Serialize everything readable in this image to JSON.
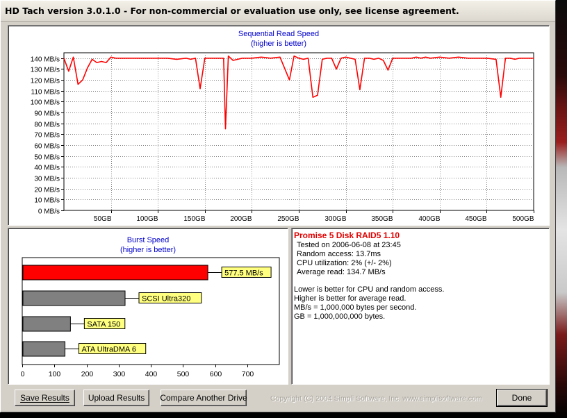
{
  "window": {
    "title": "HD Tach version 3.0.1.0  - For non-commercial or evaluation use only, see license agreement."
  },
  "sequential": {
    "title": "Sequential Read Speed",
    "subtitle": "(higher is better)"
  },
  "burst": {
    "title": "Burst Speed",
    "subtitle": "(higher is better)"
  },
  "info": {
    "title": "Promise 5 Disk RAID5 1.10",
    "tested_on": "Tested on 2006-06-08 at 23:45",
    "random_access": "Random access: 13.7ms",
    "cpu": "CPU utilization: 2% (+/- 2%)",
    "avg_read": "Average read: 134.7 MB/s",
    "notes": [
      "Lower is better for CPU and random access.",
      "Higher is better for average read.",
      "MB/s = 1,000,000 bytes per second.",
      "GB = 1,000,000,000 bytes."
    ]
  },
  "buttons": {
    "save": "Save Results",
    "upload": "Upload Results",
    "compare": "Compare Another Drive",
    "done": "Done"
  },
  "copyright": "Copyright (C) 2004 Simpli Software, Inc. www.simplisoftware.com",
  "chart_data": [
    {
      "type": "line",
      "title": "Sequential Read Speed",
      "subtitle": "(higher is better)",
      "x_unit": "GB",
      "y_unit": "MB/s",
      "xlim": [
        0,
        500
      ],
      "ylim": [
        0,
        145
      ],
      "x_ticks": [
        50,
        100,
        150,
        200,
        250,
        300,
        350,
        400,
        450,
        500
      ],
      "x_tick_labels": [
        "50GB",
        "100GB",
        "150GB",
        "200GB",
        "250GB",
        "300GB",
        "350GB",
        "400GB",
        "450GB",
        "500GB"
      ],
      "y_ticks": [
        0,
        10,
        20,
        30,
        40,
        50,
        60,
        70,
        80,
        90,
        100,
        110,
        120,
        130,
        140
      ],
      "y_tick_labels": [
        "0 MB/s",
        "10 MB/s",
        "20 MB/s",
        "30 MB/s",
        "40 MB/s",
        "50 MB/s",
        "60 MB/s",
        "70 MB/s",
        "80 MB/s",
        "90 MB/s",
        "100 MB/s",
        "110 MB/s",
        "120 MB/s",
        "130 MB/s",
        "140 MB/s"
      ],
      "grid": true,
      "color": "#ff0000",
      "series": [
        {
          "x": [
            0,
            5,
            10,
            15,
            20,
            25,
            30,
            35,
            40,
            45,
            50,
            55,
            60,
            65,
            70,
            80,
            90,
            100,
            110,
            120,
            130,
            135,
            140,
            145,
            150,
            155,
            160,
            165,
            170,
            172,
            175,
            180,
            185,
            190,
            200,
            210,
            220,
            230,
            240,
            245,
            250,
            255,
            260,
            265,
            270,
            275,
            280,
            285,
            290,
            295,
            300,
            305,
            310,
            315,
            320,
            325,
            330,
            335,
            340,
            345,
            350,
            355,
            360,
            365,
            370,
            375,
            380,
            385,
            390,
            400,
            410,
            420,
            430,
            440,
            450,
            460,
            465,
            470,
            475,
            480,
            485,
            490,
            495,
            500
          ],
          "y": [
            140,
            128,
            141,
            116,
            120,
            131,
            139,
            136,
            137,
            136,
            141,
            140,
            140,
            140,
            140,
            140,
            140,
            140,
            140,
            139,
            140,
            139,
            140,
            112,
            140,
            140,
            140,
            140,
            140,
            75,
            142,
            138,
            139,
            140,
            140,
            141,
            140,
            141,
            120,
            142,
            140,
            139,
            140,
            104,
            106,
            139,
            140,
            140,
            130,
            140,
            141,
            140,
            139,
            111,
            140,
            140,
            139,
            140,
            138,
            129,
            140,
            140,
            140,
            140,
            140,
            141,
            140,
            141,
            140,
            141,
            140,
            141,
            140,
            140,
            140,
            139,
            104,
            140,
            140,
            139,
            140,
            140,
            140,
            140
          ]
        }
      ]
    },
    {
      "type": "bar",
      "orientation": "horizontal",
      "title": "Burst Speed",
      "subtitle": "(higher is better)",
      "xlim": [
        0,
        800
      ],
      "x_ticks": [
        0,
        100,
        200,
        300,
        400,
        500,
        600,
        700
      ],
      "categories": [
        "577.5 MB/s",
        "SCSI Ultra320",
        "SATA 150",
        "ATA UltraDMA 6"
      ],
      "values": [
        577.5,
        320,
        150,
        133
      ],
      "colors": [
        "#ff0000",
        "#808080",
        "#808080",
        "#808080"
      ],
      "label_bg": "#ffff80"
    }
  ]
}
